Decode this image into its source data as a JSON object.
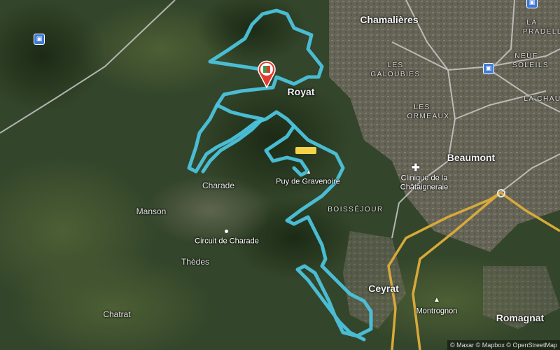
{
  "map": {
    "places": {
      "chamalieres": "Chamalières",
      "royat": "Royat",
      "beaumont": "Beaumont",
      "ceyrat": "Ceyrat",
      "romagnat": "Romagnat",
      "charade": "Charade",
      "manson": "Manson",
      "thedes": "Thèdes",
      "chatrat": "Chatrat",
      "montrognon": "Montrognon",
      "puy_gravenoire": "Puy de Gravenoire",
      "circuit_charade": "Circuit de Charade",
      "clinique_line1": "Clinique de la",
      "clinique_line2": "Châtaigneraie",
      "les_galoubies_1": "LES",
      "les_galoubies_2": "GALOUBIES",
      "les_ormeaux_1": "LES",
      "les_ormeaux_2": "ORMEAUX",
      "boissejour": "BOISSÉJOUR",
      "la_pradelle_1": "LA",
      "la_pradelle_2": "PRADELLE",
      "neuf_soleils_1": "NEUF",
      "neuf_soleils_2": "SOLEILS",
      "la_chau": "LA CHAU"
    },
    "attribution": "© Maxar © Mapbox © OpenStreetMap",
    "route_color": "#4cc3dc",
    "icons": {
      "start": "start-flag-marker",
      "transit": "train-station-icon",
      "medical": "hospital-cross-icon",
      "peak": "summit-triangle-icon",
      "poi": "circuit-dot-icon"
    }
  }
}
